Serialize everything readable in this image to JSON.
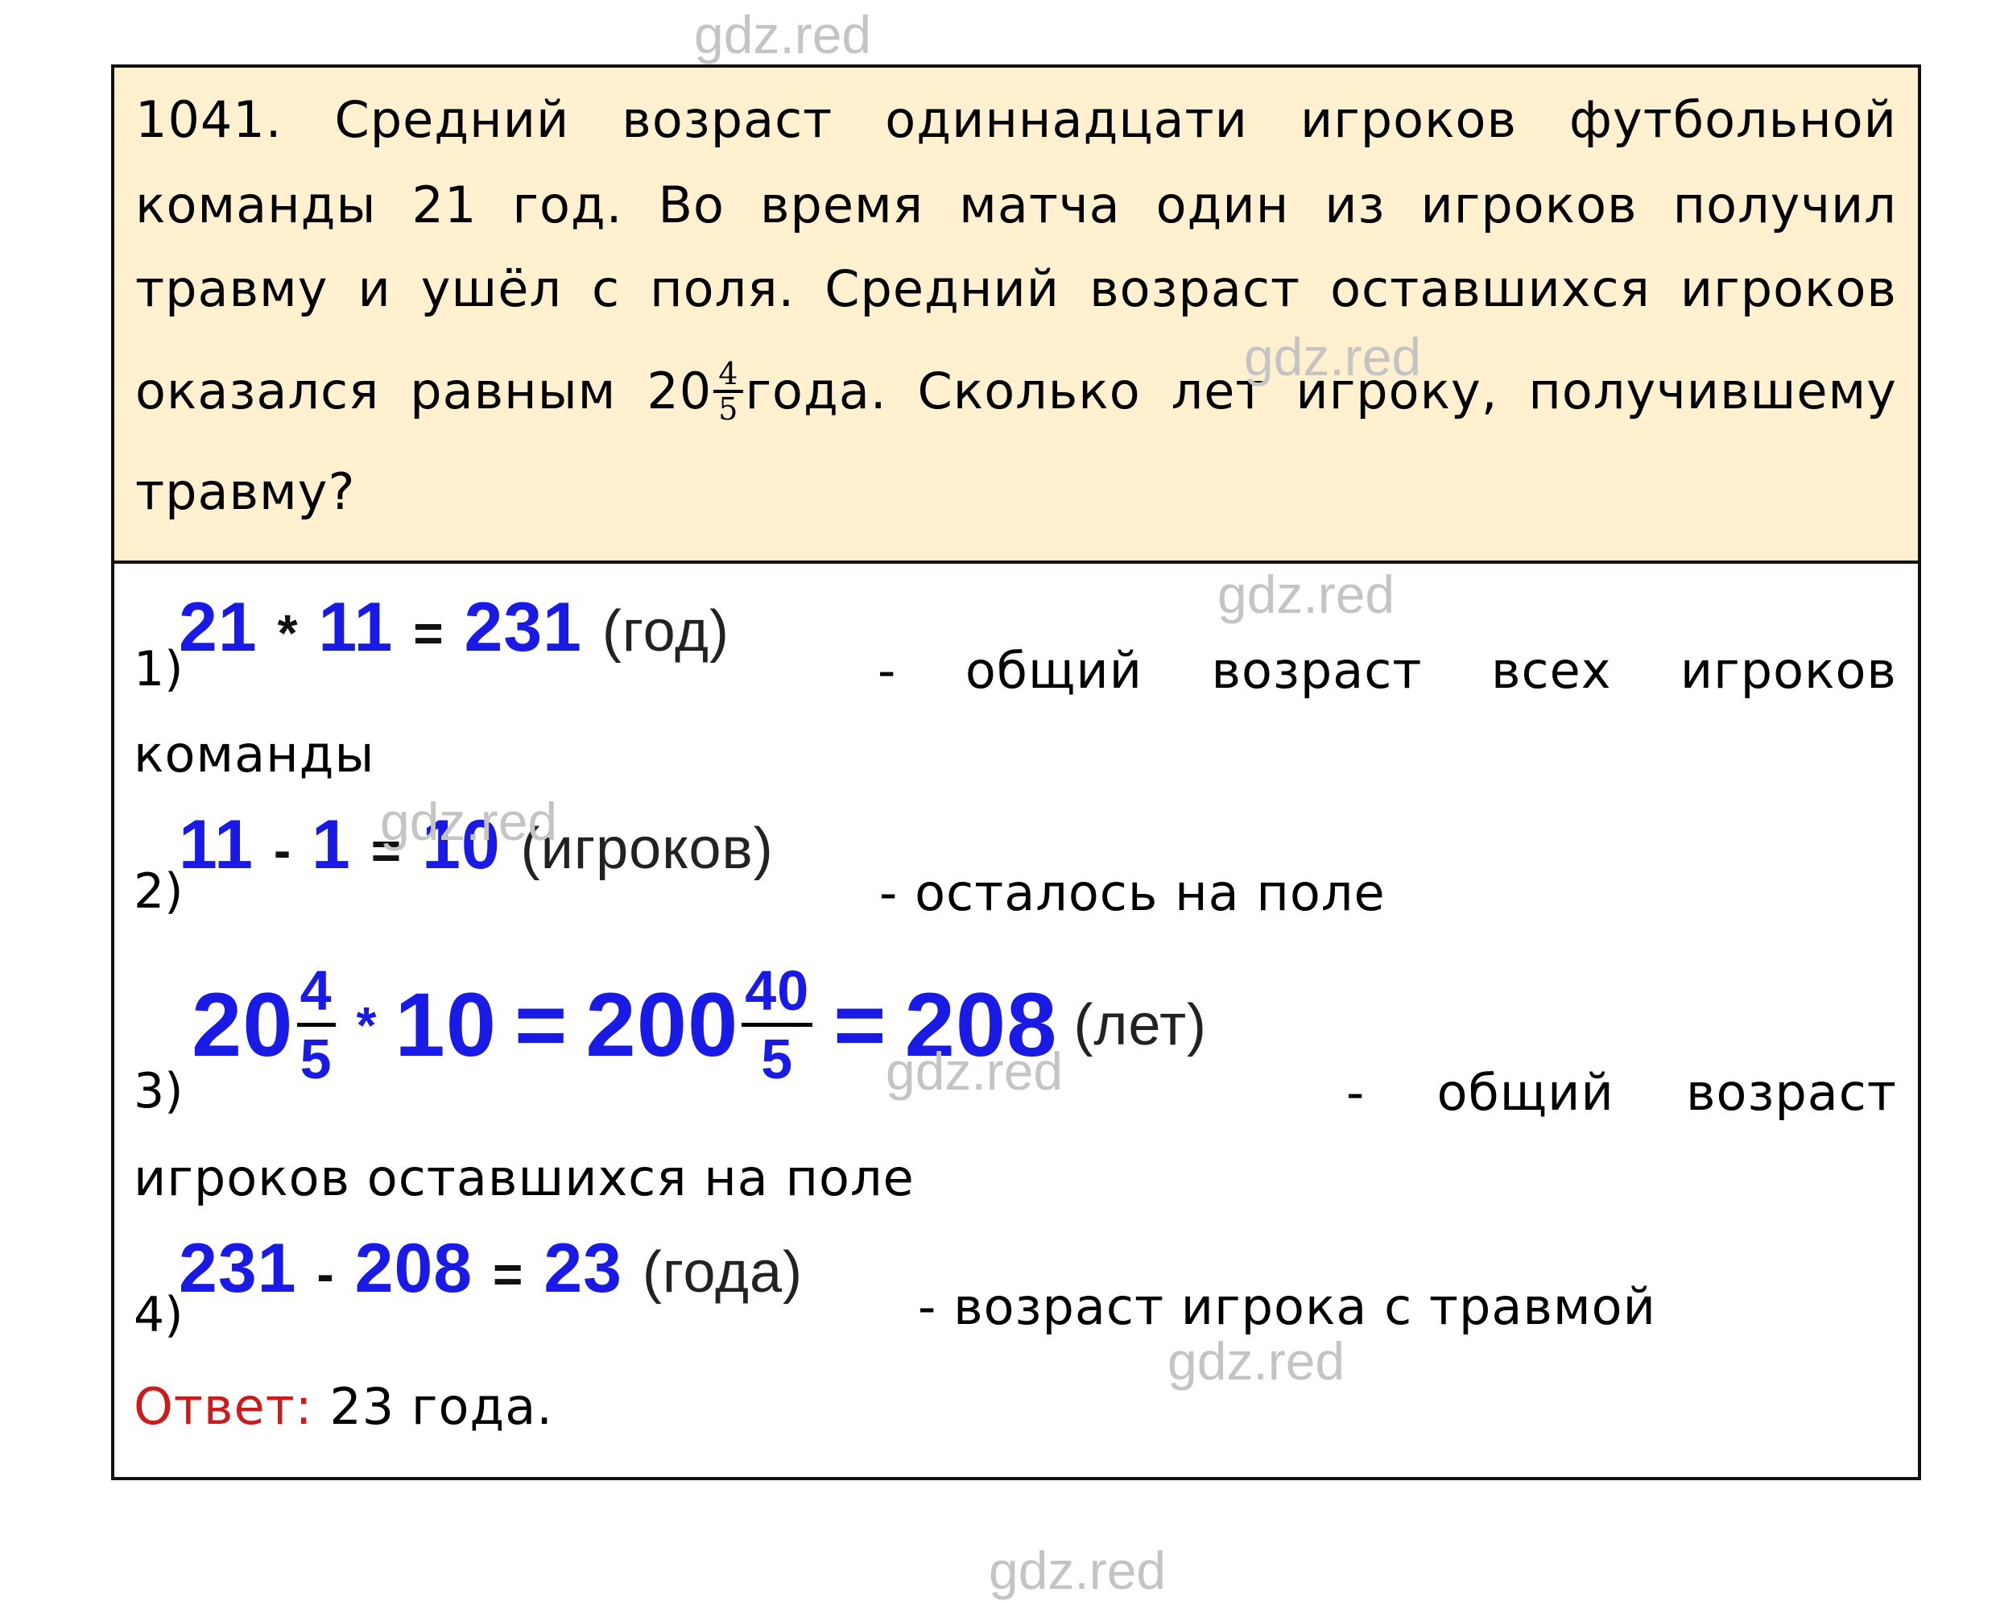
{
  "watermark": "gdz.red",
  "problem": {
    "number": "1041.",
    "lines": [
      [
        "Средний",
        "возраст",
        "одиннадцати",
        "игроков",
        "футбольной"
      ],
      [
        "команды",
        "21",
        "год.",
        "Во",
        "время",
        "матча",
        "один",
        "из",
        "игроков",
        "получил"
      ],
      [
        "травму",
        "и",
        "ушёл",
        "с",
        "поля.",
        "Средний",
        "возраст",
        "оставшихся",
        "игроков"
      ]
    ],
    "line4": {
      "before": [
        "оказался",
        "равным"
      ],
      "mixed_whole": "20",
      "mixed_num": "4",
      "mixed_den": "5",
      "after_frac": "года.",
      "rest": [
        "Сколько",
        "лет",
        "игроку,",
        "получившему"
      ]
    },
    "line5": "травму?"
  },
  "solution": {
    "step1": {
      "num": "1)",
      "a": "21",
      "op1": "*",
      "b": "11",
      "eq": "=",
      "result": "231",
      "unit": "(год)",
      "desc_words": [
        "-",
        "общий",
        "возраст",
        "всех",
        "игроков"
      ],
      "desc_cont": "команды"
    },
    "step2": {
      "num": "2)",
      "a": "11",
      "op1": "-",
      "b": "1",
      "eq": "=",
      "result": "10",
      "unit": "(игроков)",
      "desc": "- осталось на поле"
    },
    "step3": {
      "num": "3)",
      "whole1": "20",
      "num1": "4",
      "den1": "5",
      "op1": "*",
      "b": "10",
      "eq1": "=",
      "whole2": "200",
      "num2": "40",
      "den2": "5",
      "eq2": "=",
      "result": "208",
      "unit": "(лет)",
      "desc_words": [
        "-",
        "общий",
        "возраст"
      ],
      "desc_cont": "игроков оставшихся на поле"
    },
    "step4": {
      "num": "4)",
      "a": "231",
      "op1": "-",
      "b": "208",
      "eq": "=",
      "result": "23",
      "unit": "(года)",
      "desc": "- возраст игрока с травмой"
    },
    "answer": {
      "label": "Ответ:",
      "value": "23 года."
    }
  },
  "colors": {
    "question_bg": "#fff0cf",
    "math_blue": "#1a1ae6",
    "answer_red": "#cc1b1b",
    "watermark_gray": "#c4c4c4"
  }
}
